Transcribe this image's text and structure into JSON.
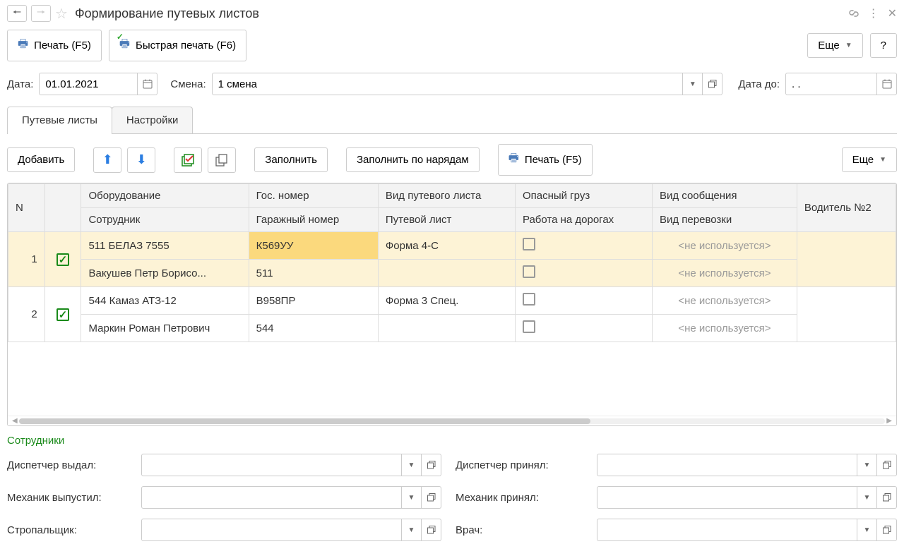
{
  "header": {
    "title": "Формирование путевых листов"
  },
  "toolbar": {
    "print": "Печать (F5)",
    "fast_print": "Быстрая печать (F6)",
    "more": "Еще",
    "help": "?"
  },
  "filters": {
    "date_label": "Дата:",
    "date_value": "01.01.2021",
    "shift_label": "Смена:",
    "shift_value": "1 смена",
    "date_to_label": "Дата до:",
    "date_to_value": ". ."
  },
  "tabs": [
    {
      "label": "Путевые листы",
      "active": true
    },
    {
      "label": "Настройки",
      "active": false
    }
  ],
  "grid_toolbar": {
    "add": "Добавить",
    "fill": "Заполнить",
    "fill_orders": "Заполнить по нарядам",
    "print": "Печать (F5)",
    "more": "Еще"
  },
  "grid": {
    "headers": {
      "n": "N",
      "equipment": "Оборудование",
      "employee": "Сотрудник",
      "gos_number": "Гос. номер",
      "garage_number": "Гаражный номер",
      "waybill_type": "Вид путевого листа",
      "waybill": "Путевой лист",
      "dangerous": "Опасный груз",
      "roads": "Работа на дорогах",
      "message_type": "Вид сообщения",
      "transport_type": "Вид перевозки",
      "driver2": "Водитель №2"
    },
    "not_used": "<не используется>",
    "rows": [
      {
        "n": "1",
        "checked": true,
        "selected": true,
        "equipment": "511 БЕЛАЗ 7555",
        "employee": "Вакушев Петр Борисо...",
        "gos_number": "К569УУ",
        "garage_number": "511",
        "waybill_type": "Форма 4-С",
        "waybill": "",
        "dangerous": false,
        "roads": false,
        "message_type": "<не используется>",
        "transport_type": "<не используется>"
      },
      {
        "n": "2",
        "checked": true,
        "selected": false,
        "equipment": "544 Камаз АТЗ-12",
        "employee": "Маркин Роман Петрович",
        "gos_number": "В958ПР",
        "garage_number": "544",
        "waybill_type": "Форма 3 Спец.",
        "waybill": "",
        "dangerous": false,
        "roads": false,
        "message_type": "<не используется>",
        "transport_type": "<не используется>"
      }
    ]
  },
  "staff": {
    "section_title": "Сотрудники",
    "dispatcher_out": "Диспетчер выдал:",
    "dispatcher_in": "Диспетчер принял:",
    "mechanic_out": "Механик выпустил:",
    "mechanic_in": "Механик принял:",
    "slinger": "Стропальщик:",
    "doctor": "Врач:"
  }
}
